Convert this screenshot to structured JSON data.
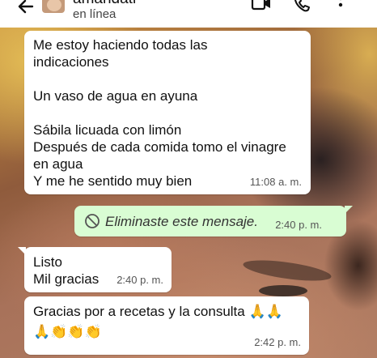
{
  "header": {
    "contact_name": "amandati",
    "status": "en línea",
    "icons": [
      "back-arrow-icon",
      "video-call-icon",
      "phone-icon",
      "more-options-icon"
    ]
  },
  "messages": [
    {
      "direction": "incoming",
      "lines": [
        "Me estoy haciendo todas las",
        "indicaciones",
        "",
        "Un vaso de agua en ayuna",
        "",
        "Sábila licuada con limón",
        "Después de cada comida tomo el vinagre",
        "en agua",
        "Y me he sentido muy bien"
      ],
      "time": "11:08 a. m."
    },
    {
      "direction": "outgoing",
      "deleted": true,
      "text": "Eliminaste este mensaje.",
      "time": "2:40 p. m."
    },
    {
      "direction": "incoming",
      "lines": [
        "Listo",
        "Mil gracias"
      ],
      "time": "2:40 p. m."
    },
    {
      "direction": "incoming",
      "line1": "Gracias por a recetas y la consulta",
      "emoji1": "🙏🙏",
      "emoji2": "🙏👏👏👏",
      "time": "2:42 p. m."
    }
  ],
  "colors": {
    "incoming_bubble": "#ffffff",
    "outgoing_bubble": "#d9fdd3",
    "timestamp": "#555555"
  }
}
